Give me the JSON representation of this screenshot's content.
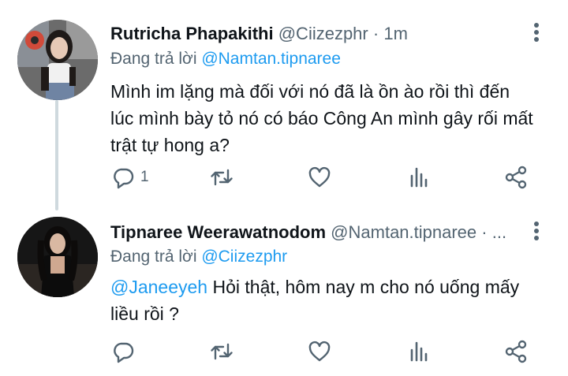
{
  "tweets": [
    {
      "name": "Rutricha Phapakithi",
      "handle": "@Ciizezphr",
      "separator": "·",
      "time": "1m",
      "reply_prefix": "Đang trả lời ",
      "reply_to": "@Namtan.tipnaree",
      "body_lines": [
        "Mình im lặng mà đối với nó đã là ồn ào rồi thì đến",
        "lúc mình bày tỏ nó có báo Công An mình gây rối mất",
        "trật tự hong a?"
      ],
      "reply_count": "1"
    },
    {
      "name": "Tipnaree Weerawatnodom",
      "handle": "@Namtan.tipnaree",
      "separator": "·",
      "time": "...",
      "reply_prefix": "Đang trả lời ",
      "reply_to": "@Ciizezphr",
      "body_mention": "@Janeeyeh",
      "body_line1_rest": " Hỏi thật, hôm nay m cho nó uống mấy",
      "body_line2": "liều rồi ?",
      "reply_count": ""
    }
  ],
  "icons": {
    "reply": "reply-icon",
    "retweet": "retweet-icon",
    "like": "heart-icon",
    "views": "views-icon",
    "share": "share-icon",
    "more": "more-vertical-icon"
  },
  "colors": {
    "accent": "#1d9bf0",
    "secondary_text": "#536471",
    "primary_text": "#0f1419",
    "thread_line": "#cfd9de"
  }
}
